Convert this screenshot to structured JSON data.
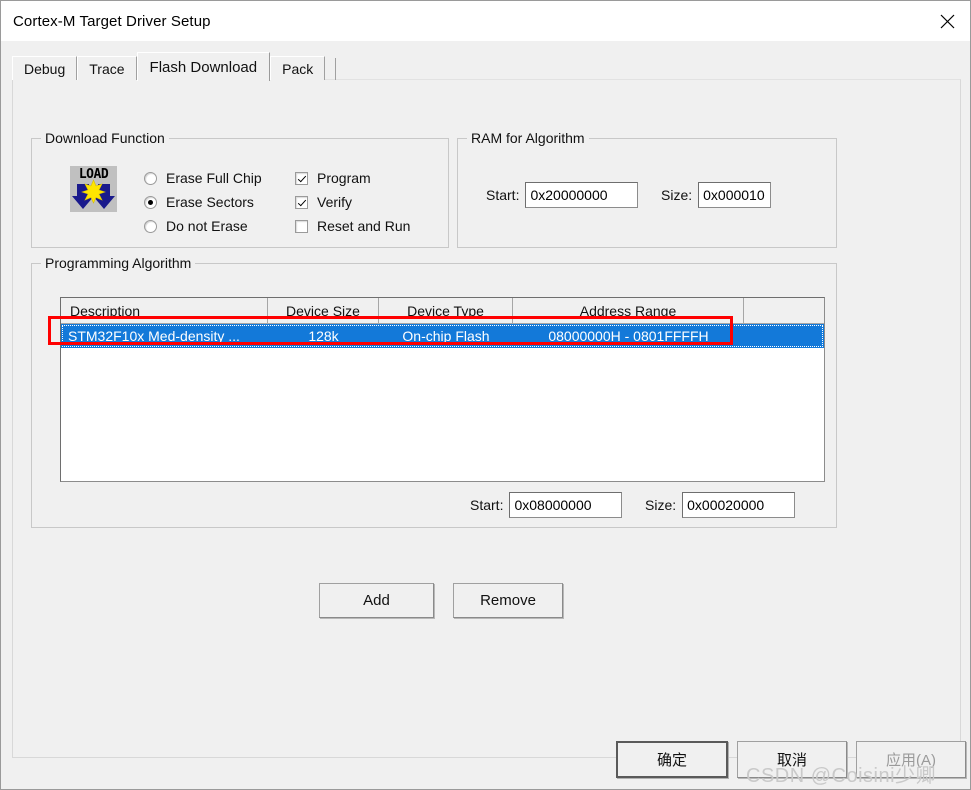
{
  "window": {
    "title": "Cortex-M Target Driver Setup",
    "close_icon": "close-icon"
  },
  "tabs": [
    {
      "label": "Debug",
      "active": false
    },
    {
      "label": "Trace",
      "active": false
    },
    {
      "label": "Flash Download",
      "active": true
    },
    {
      "label": "Pack",
      "active": false
    }
  ],
  "download_function": {
    "legend": "Download Function",
    "icon_label": "LOAD",
    "radios": [
      {
        "label": "Erase Full Chip",
        "checked": false
      },
      {
        "label": "Erase Sectors",
        "checked": true
      },
      {
        "label": "Do not Erase",
        "checked": false
      }
    ],
    "checkboxes": [
      {
        "label": "Program",
        "checked": true
      },
      {
        "label": "Verify",
        "checked": true
      },
      {
        "label": "Reset and Run",
        "checked": false
      }
    ]
  },
  "ram_for_algorithm": {
    "legend": "RAM for Algorithm",
    "start_label": "Start:",
    "start_value": "0x20000000",
    "size_label": "Size:",
    "size_value": "0x000010"
  },
  "programming_algorithm": {
    "legend": "Programming Algorithm",
    "columns": [
      "Description",
      "Device Size",
      "Device Type",
      "Address Range",
      ""
    ],
    "rows": [
      {
        "description": "STM32F10x Med-density ...",
        "device_size": "128k",
        "device_type": "On-chip Flash",
        "address_range": "08000000H - 0801FFFFH",
        "extra": "",
        "selected": true,
        "annotated": true
      }
    ],
    "start_label": "Start:",
    "start_value": "0x08000000",
    "size_label": "Size:",
    "size_value": "0x00020000",
    "add_label": "Add",
    "remove_label": "Remove"
  },
  "footer": {
    "ok_label": "确定",
    "cancel_label": "取消",
    "apply_label": "应用(A)",
    "apply_disabled": true
  },
  "watermark": {
    "text": "CSDN @Coisini少卿"
  },
  "colors": {
    "selection_blue": "#1379d9",
    "annotation_red": "#ff0000",
    "window_bg": "#f0f0f0",
    "field_bg": "#ffffff",
    "icon_arrow_blue": "#1a1a8c",
    "icon_star_yellow": "#ffe500"
  }
}
